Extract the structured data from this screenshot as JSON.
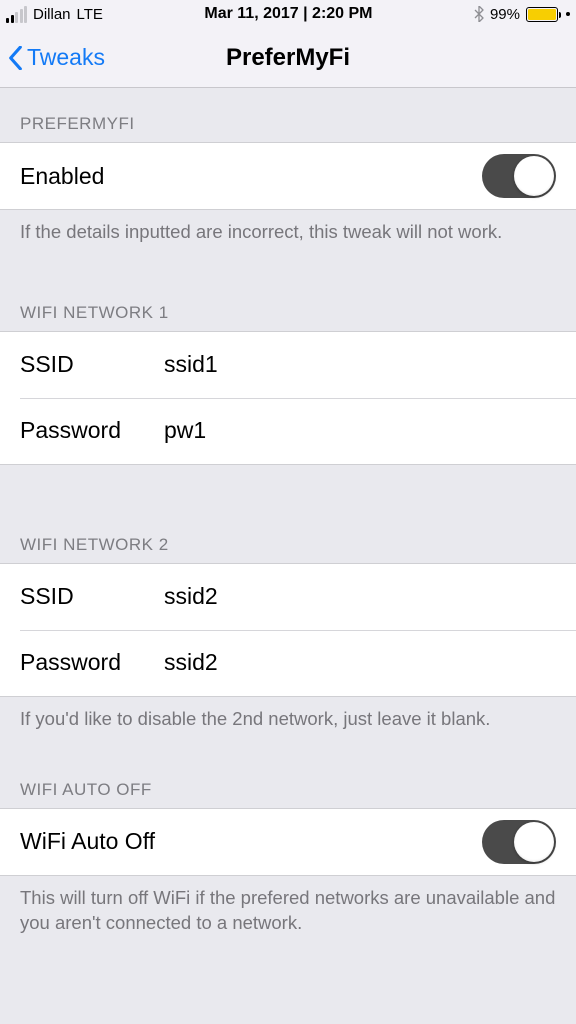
{
  "statusbar": {
    "carrier": "Dillan",
    "network": "LTE",
    "datetime": "Mar 11, 2017 | 2:20 PM",
    "battery_pct": "99%"
  },
  "nav": {
    "back_label": "Tweaks",
    "title": "PreferMyFi"
  },
  "sections": {
    "prefermyfi": {
      "header": "PREFERMYFI",
      "enabled_label": "Enabled",
      "enabled_value": true,
      "footer": "If the details inputted are incorrect, this tweak will not work."
    },
    "wifi1": {
      "header": "WIFI NETWORK 1",
      "ssid_label": "SSID",
      "ssid_value": "ssid1",
      "password_label": "Password",
      "password_value": "pw1"
    },
    "wifi2": {
      "header": "WIFI NETWORK 2",
      "ssid_label": "SSID",
      "ssid_value": "ssid2",
      "password_label": "Password",
      "password_value": "ssid2",
      "footer": "If you'd like to disable the 2nd network, just leave it blank."
    },
    "autooff": {
      "header": "WIFI AUTO OFF",
      "label": "WiFi Auto Off",
      "value": true,
      "footer": "This will turn off WiFi if the prefered networks are unavailable and you aren't connected to a network."
    }
  }
}
